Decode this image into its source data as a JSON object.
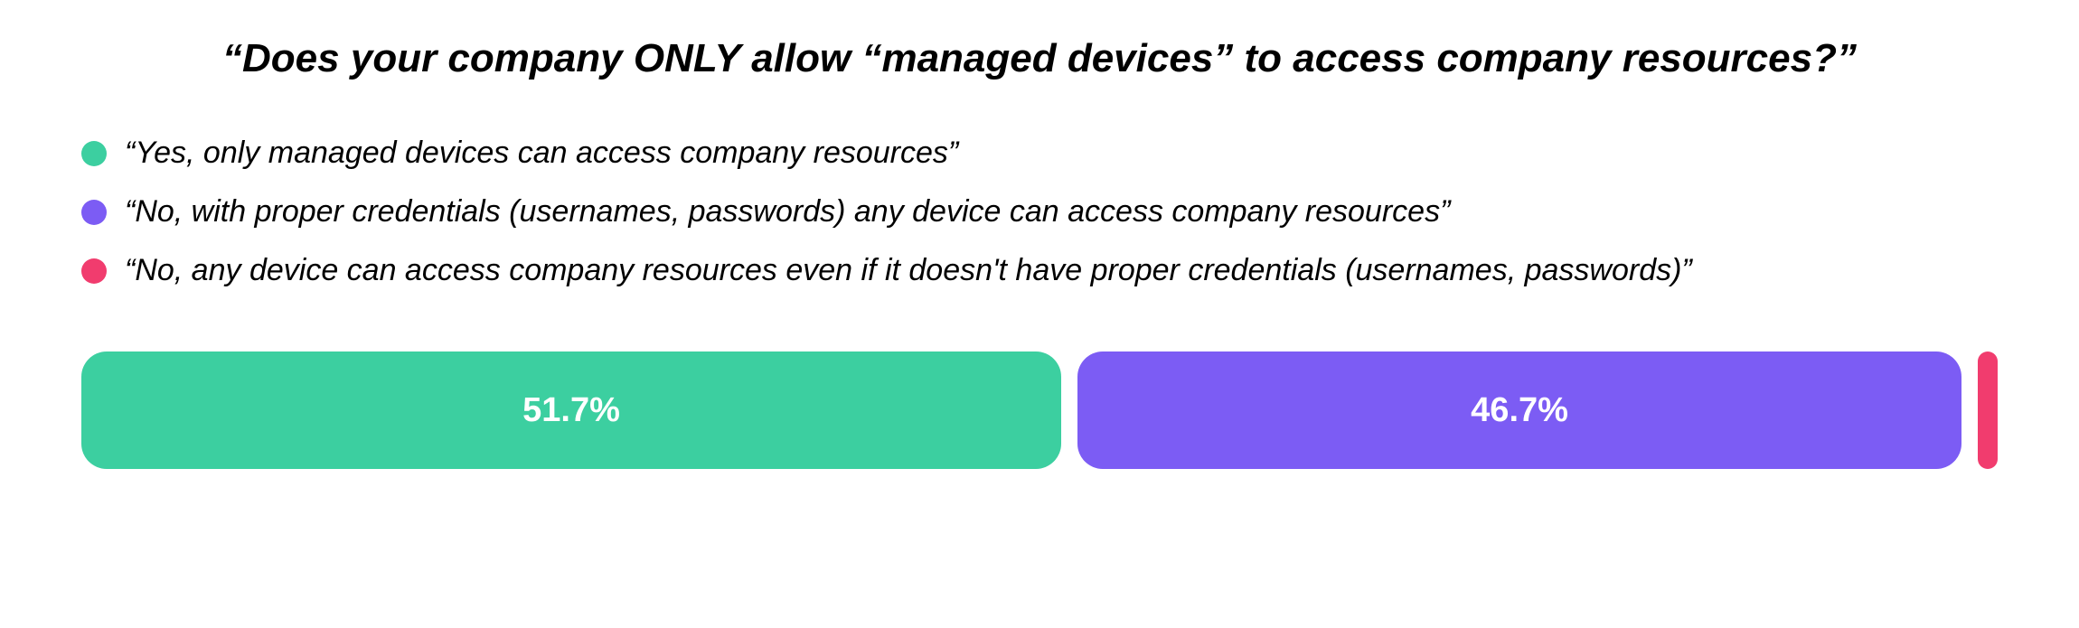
{
  "title": "“Does your company ONLY allow “managed devices” to access company resources?”",
  "legend": {
    "items": [
      {
        "label": "“Yes, only managed devices can access company resources”",
        "color": "#3ccfa0"
      },
      {
        "label": "“No, with proper credentials (usernames, passwords) any device can access company resources”",
        "color": "#7c5cf4"
      },
      {
        "label": "“No, any device can access company resources even if it doesn't have proper credentials (usernames, passwords)”",
        "color": "#f13c6e"
      }
    ]
  },
  "segments": [
    {
      "label": "51.7%",
      "color": "#3ccfa0",
      "value": 51.7
    },
    {
      "label": "46.7%",
      "color": "#7c5cf4",
      "value": 46.7
    },
    {
      "label": "",
      "color": "#f13c6e",
      "value": 1.6
    }
  ],
  "chart_data": {
    "type": "bar",
    "title": "Does your company ONLY allow “managed devices” to access company resources?",
    "categories": [
      "Yes, only managed devices can access company resources",
      "No, with proper credentials (usernames, passwords) any device can access company resources",
      "No, any device can access company resources even if it doesn't have proper credentials (usernames, passwords)"
    ],
    "values": [
      51.7,
      46.7,
      1.6
    ],
    "colors": [
      "#3ccfa0",
      "#7c5cf4",
      "#f13c6e"
    ],
    "xlabel": "",
    "ylabel": "",
    "unit": "%"
  }
}
